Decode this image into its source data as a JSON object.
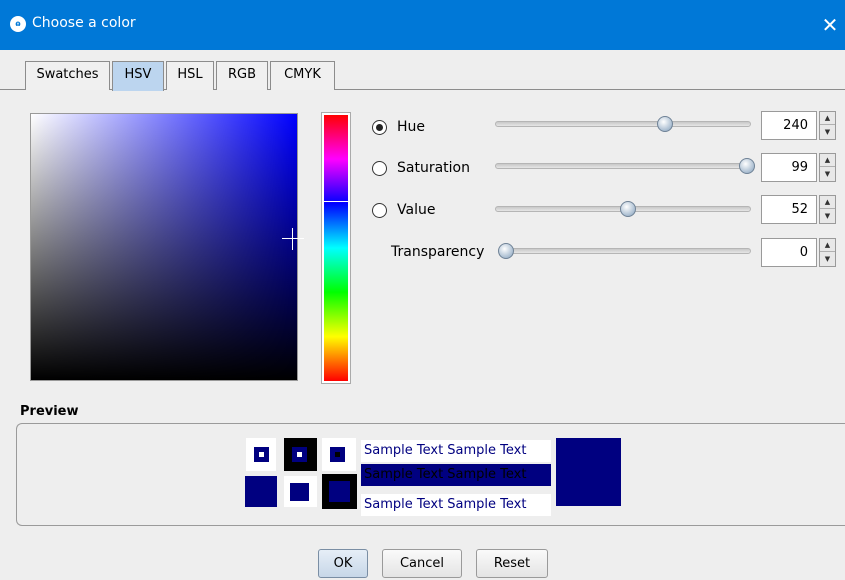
{
  "window": {
    "title": "Choose a color",
    "icon": "app-icon",
    "icon_glyph": "ɷ",
    "close_glyph": "✕"
  },
  "tabs": [
    {
      "label": "Swatches",
      "mnemonic": "S",
      "active": false
    },
    {
      "label": "HSV",
      "mnemonic": "H",
      "active": true
    },
    {
      "label": "HSL",
      "mnemonic": "L",
      "active": false
    },
    {
      "label": "RGB",
      "mnemonic": "G",
      "active": false
    },
    {
      "label": "CMYK",
      "mnemonic": "M",
      "active": false
    }
  ],
  "controls": {
    "hue": {
      "label": "Hue",
      "value": "240",
      "selected": true,
      "slider_fraction": 0.667
    },
    "saturation": {
      "label": "Saturation",
      "value": "99",
      "selected": false,
      "slider_fraction": 0.99
    },
    "value": {
      "label": "Value",
      "value": "52",
      "selected": false,
      "slider_fraction": 0.52
    },
    "transparency": {
      "label": "Transparency",
      "value": "0",
      "slider_fraction": 0.0
    }
  },
  "colors": {
    "selected": "#000085",
    "accent": "#0078d7"
  },
  "preview": {
    "label": "Preview",
    "sample_text": "Sample Text  Sample Text",
    "rows": [
      {
        "text": "Sample Text  Sample Text",
        "style": "on-white"
      },
      {
        "text": "Sample Text  Sample Text",
        "style": "on-color"
      },
      {
        "text": "Sample Text  Sample Text",
        "style": "on-white"
      }
    ]
  },
  "buttons": {
    "ok": "OK",
    "cancel": "Cancel",
    "reset": "Reset"
  }
}
